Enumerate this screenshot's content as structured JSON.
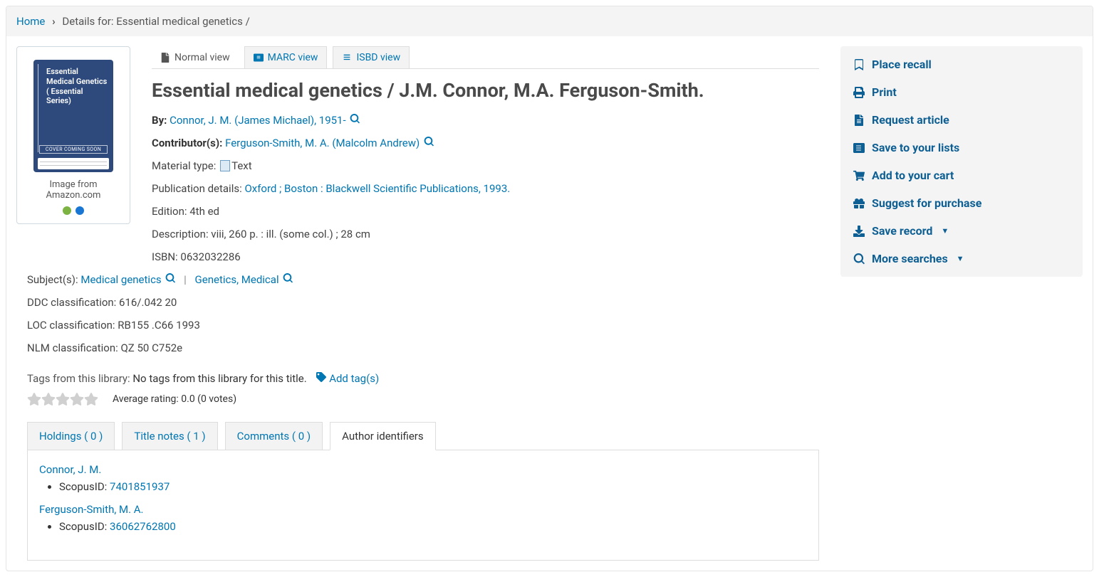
{
  "breadcrumb": {
    "home": "Home",
    "details_prefix": "Details for: ",
    "details_title": "Essential medical genetics /"
  },
  "cover": {
    "title_lines": "Essential Medical Genetics ( Essential Series)",
    "coming": "COVER COMING SOON",
    "amazon_label": "Image from Amazon.com"
  },
  "views": {
    "normal": "Normal view",
    "marc": "MARC view",
    "isbd": "ISBD view"
  },
  "title": "Essential medical genetics / J.M. Connor, M.A. Ferguson-Smith.",
  "by_label": "By:",
  "by_author": "Connor, J. M. (James Michael), 1951-",
  "contrib_label": "Contributor(s):",
  "contrib_name": "Ferguson-Smith, M. A. (Malcolm Andrew)",
  "material_type_label": "Material type: ",
  "material_type_value": "Text",
  "pubdetails_label": "Publication details: ",
  "pub_place": "Oxford ; Boston : ",
  "pub_publisher": "Blackwell Scientific Publications, ",
  "pub_year": "1993.",
  "edition_label": "Edition: ",
  "edition_value": "4th ed",
  "description_label": "Description: ",
  "description_value": "viii, 260 p. : ill. (some col.) ; 28 cm",
  "isbn_label": "ISBN: ",
  "isbn_value": "0632032286",
  "subjects_label": "Subject(s): ",
  "subject1": "Medical genetics",
  "subject2": "Genetics, Medical",
  "ddc_label": "DDC classification: ",
  "ddc_value": "616/.042 20",
  "loc_label": "LOC classification: ",
  "loc_value": "RB155 .C66 1993",
  "nlm_label": "NLM classification: ",
  "nlm_value": "QZ 50 C752e",
  "tags_label": "Tags from this library: ",
  "no_tags": "No tags from this library for this title.",
  "add_tags": "Add tag(s)",
  "rating_text": "Average rating: 0.0 (0 votes)",
  "tabs": {
    "holdings": "Holdings ( 0 )",
    "title_notes": "Title notes ( 1 )",
    "comments": "Comments ( 0 )",
    "author_ids": "Author identifiers"
  },
  "author_ids": {
    "a1_name": "Connor, J. M.",
    "a1_scopus_label": "ScopusID: ",
    "a1_scopus": "7401851937",
    "a2_name": "Ferguson-Smith, M. A.",
    "a2_scopus_label": "ScopusID: ",
    "a2_scopus": "36062762800"
  },
  "sidebar": {
    "place_recall": "Place recall",
    "print": "Print",
    "request_article": "Request article",
    "save_lists": "Save to your lists",
    "add_cart": "Add to your cart",
    "suggest": "Suggest for purchase",
    "save_record": "Save record",
    "more_searches": "More searches"
  }
}
